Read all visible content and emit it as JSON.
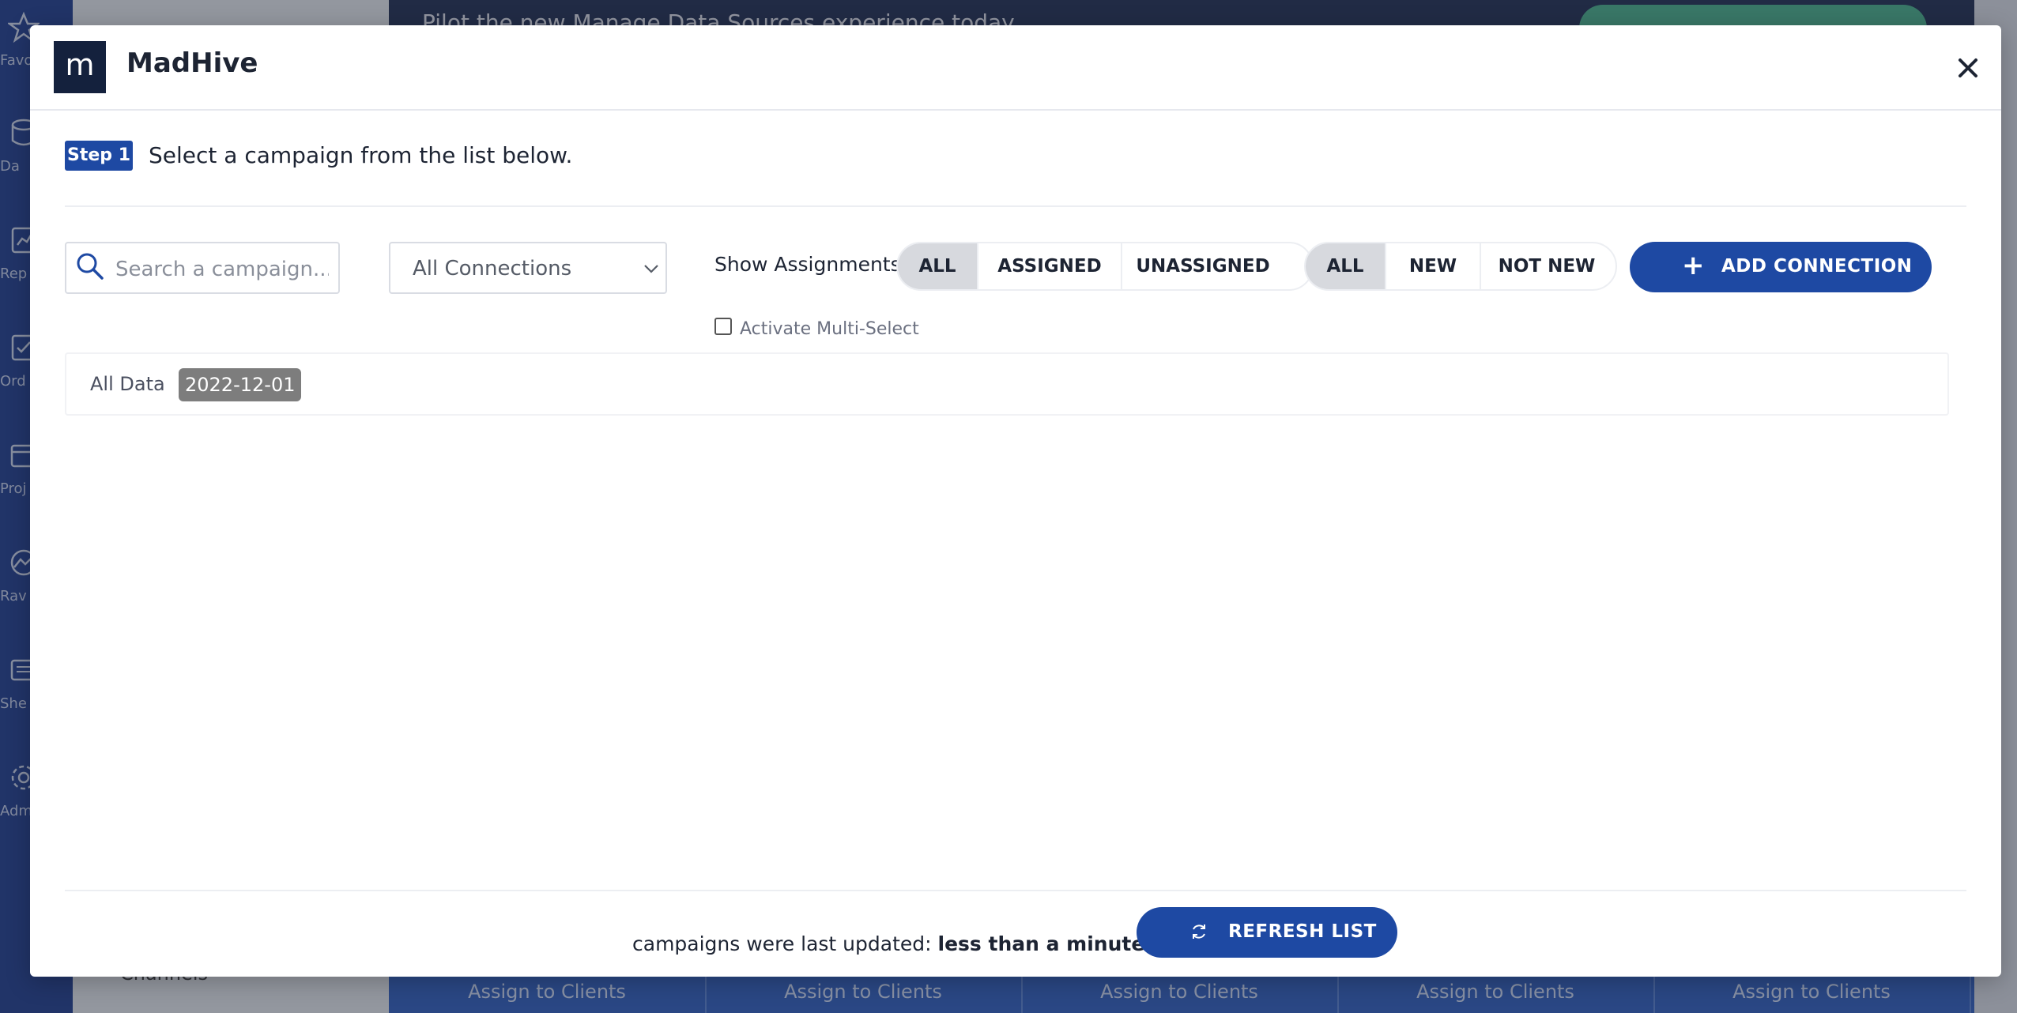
{
  "background": {
    "banner_text": "Pilot the new Manage Data Sources experience today.",
    "sidebar_items": [
      "Favo",
      "Da",
      "Rep",
      "Ord",
      "Proj",
      "Rav",
      "She",
      "Adm"
    ],
    "panel_label": "Channels",
    "bottom_cells": [
      "Assign to Clients",
      "Assign to Clients",
      "Assign to Clients",
      "Assign to Clients",
      "Assign to Clients"
    ]
  },
  "modal": {
    "logo_letter": "m",
    "title": "MadHive",
    "close_icon": "close-icon"
  },
  "step": {
    "badge": "Step 1",
    "text": "Select a campaign from the list below."
  },
  "toolbar": {
    "search_placeholder": "Search a campaign...",
    "connections_selected": "All Connections",
    "show_assignments_label": "Show Assignments:",
    "assignment_filters": [
      "ALL",
      "ASSIGNED",
      "UNASSIGNED"
    ],
    "assignment_active": "ALL",
    "newness_filters": [
      "ALL",
      "NEW",
      "NOT NEW"
    ],
    "newness_active": "ALL",
    "add_connection_label": "ADD CONNECTION",
    "multi_select_label": "Activate Multi-Select"
  },
  "data_row": {
    "all_data_label": "All Data",
    "date_chip": "2022-12-01"
  },
  "footer": {
    "updated_prefix": "campaigns were last updated:",
    "updated_value": "less than a minute ago",
    "refresh_label": "REFRESH LIST"
  },
  "colors": {
    "primary": "#1e49a3",
    "logo_bg": "#14213d",
    "chip_bg": "#7d7d7d",
    "sidebar_bg": "#1c3b8e"
  }
}
